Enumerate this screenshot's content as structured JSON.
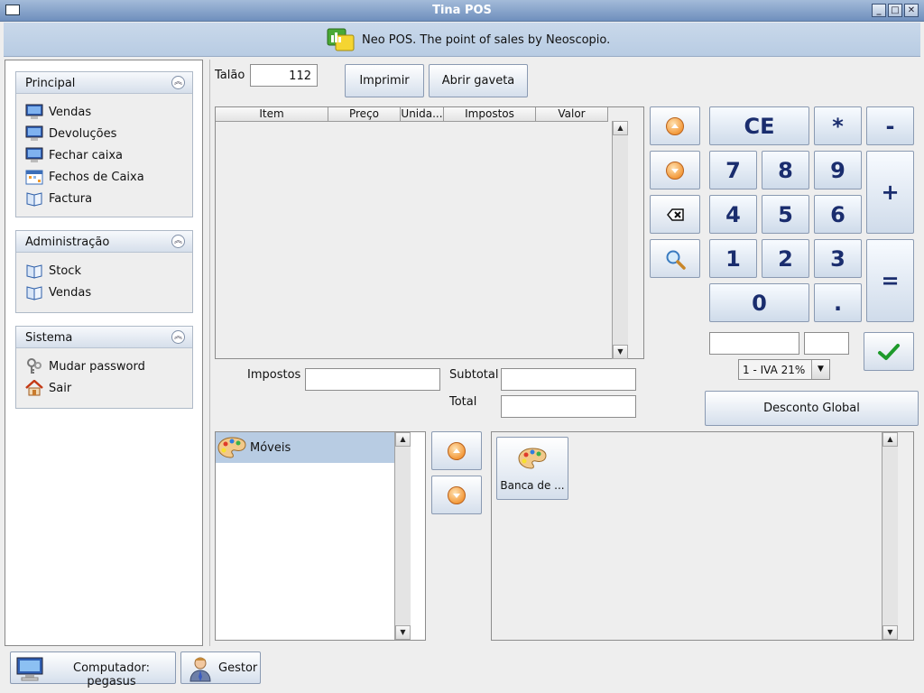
{
  "window": {
    "title": "Tina POS"
  },
  "banner": {
    "text": "Neo POS. The point of sales by Neoscopio."
  },
  "sidebar": {
    "groups": [
      {
        "title": "Principal",
        "items": [
          {
            "label": "Vendas",
            "icon": "monitor-icon"
          },
          {
            "label": "Devoluções",
            "icon": "monitor-icon"
          },
          {
            "label": "Fechar caixa",
            "icon": "monitor-icon"
          },
          {
            "label": "Fechos de Caixa",
            "icon": "calendar-icon"
          },
          {
            "label": "Factura",
            "icon": "book-icon"
          }
        ]
      },
      {
        "title": "Administração",
        "items": [
          {
            "label": "Stock",
            "icon": "book-icon"
          },
          {
            "label": "Vendas",
            "icon": "book-icon"
          }
        ]
      },
      {
        "title": "Sistema",
        "items": [
          {
            "label": "Mudar password",
            "icon": "keys-icon"
          },
          {
            "label": "Sair",
            "icon": "home-icon"
          }
        ]
      }
    ]
  },
  "sale": {
    "ticket_label": "Talão",
    "ticket_number": "112",
    "print_label": "Imprimir",
    "drawer_label": "Abrir gaveta",
    "columns": [
      "Item",
      "Preço",
      "Unida...",
      "Impostos",
      "Valor"
    ],
    "taxes_label": "Impostos",
    "subtotal_label": "Subtotal",
    "total_label": "Total",
    "taxes_value": "",
    "subtotal_value": "",
    "total_value": ""
  },
  "keypad": {
    "ce": "CE",
    "mul": "*",
    "minus": "-",
    "plus": "+",
    "eq": "=",
    "k7": "7",
    "k8": "8",
    "k9": "9",
    "k4": "4",
    "k5": "5",
    "k6": "6",
    "k1": "1",
    "k2": "2",
    "k3": "3",
    "k0": "0",
    "dot": ".",
    "tax_selected": "1 - IVA 21%",
    "discount_label": "Desconto Global"
  },
  "catalog": {
    "categories": [
      "Móveis"
    ],
    "products": [
      "Banca de ..."
    ]
  },
  "status": {
    "computer": "Computador: pegasus",
    "user": "Gestor"
  }
}
